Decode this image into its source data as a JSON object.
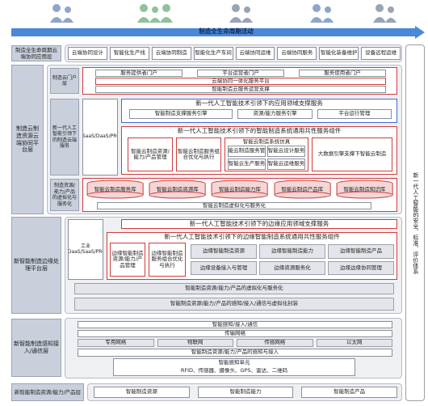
{
  "top_banner": {
    "label": "制造全生命周期活动"
  },
  "top_app": {
    "label": "制造全生命周期云端协同应用层",
    "items": [
      "云端协同设计",
      "智能化生产线",
      "云端协同制造",
      "智能化生产车间",
      "云端协同运维",
      "云端协同服务",
      "智能化装备维护",
      "设备远程运维"
    ]
  },
  "portal": {
    "label": "制造云门户层",
    "items": [
      "服务提供者门户",
      "平台运营者门户",
      "服务使用者门户"
    ],
    "sub1": "云端协同一体化服务平台",
    "sub2": "智能制造云服务运营支撑"
  },
  "platform": {
    "label": "制造云制造资源云端协同平台层",
    "new_ai_top": "新一代人工智能技术引领下的应用领域支撑服务",
    "row1": [
      "智能制造支撑服务引擎",
      "资源/能力服务引擎",
      "平台运行管理"
    ],
    "inner_label": "新一代人工智能引领下的制造云端服务",
    "iaas": "IaaS/PaaS/SaaS/DaaS/PROaaS/CaaS",
    "middle_title": "新一代人工智能技术引领下的智能制造系统通用共性服务组件",
    "middle_items": [
      "智能云制造资源/能力/产品管理",
      "智能云制造服务组合优化与执行",
      "智能云制造系统仿真",
      "大数据引擎支撑下智能云制造"
    ],
    "sub_items": [
      "智能云制造服务管理",
      "智能云设计服务",
      "智能云生产服务",
      "智能云运维服务"
    ],
    "bottom_label": "制造资源/能力/产品的虚拟化与服务化",
    "cylinders": [
      "智能云制造服务库",
      "智能云制造资源库",
      "智能云制造能力库",
      "智能云制造产品库",
      "智能云制造知识库"
    ],
    "cyl_footer": "智能云制造虚拟化与服务化"
  },
  "edge": {
    "label": "新智能制造边缘处理平台层",
    "top": "新一代人工智能技术引领下的边缘应用领域支撑服务",
    "iaas": "工业IaaS/PaaS/DaaS/SaaS/PROaaS/CaaS",
    "middle_title": "新一代人工智能技术引领下的边缘智能制造系统通用共性服务组件",
    "boxes": [
      "边缘智能制造资源/能力/产品管理",
      "边缘智能制造服务组合优化与执行",
      "边缘智能制造资源",
      "边缘智能制造能力",
      "边缘智能制造产品",
      "边缘设备接入与管理",
      "边缘资源服务化",
      "边缘边缘协同管理"
    ],
    "row1": "智能制造资源/能力/产品的虚拟化与服务化",
    "row2": "智能制造资源/能力/产品的感知/接入/通信与虚拟化封装"
  },
  "perception": {
    "label": "新智能制造感知接入/通信层",
    "top": "智能感知/接入/通信",
    "net": "传输网络",
    "nets": [
      "专用网络",
      "物联网",
      "传感网络",
      "以太网"
    ],
    "access": "智能制造资源/能力/产品的感知与接入",
    "sensors_title": "智能感知单元",
    "sensors": "RFID、传感器、摄像头、GPS、雷达、二维码"
  },
  "bottom": {
    "label": "新智能制造资源/能力/产品层",
    "items": [
      "智能制造资源",
      "智能制造能力",
      "智能制造产品"
    ]
  },
  "side": {
    "label": "新一代人工智能的安全、标准、评价体系"
  },
  "colors": {
    "arrow": "#4a88d8",
    "red": "#d23b3b",
    "blue": "#3b6fd2",
    "band": "#eef0f4"
  }
}
